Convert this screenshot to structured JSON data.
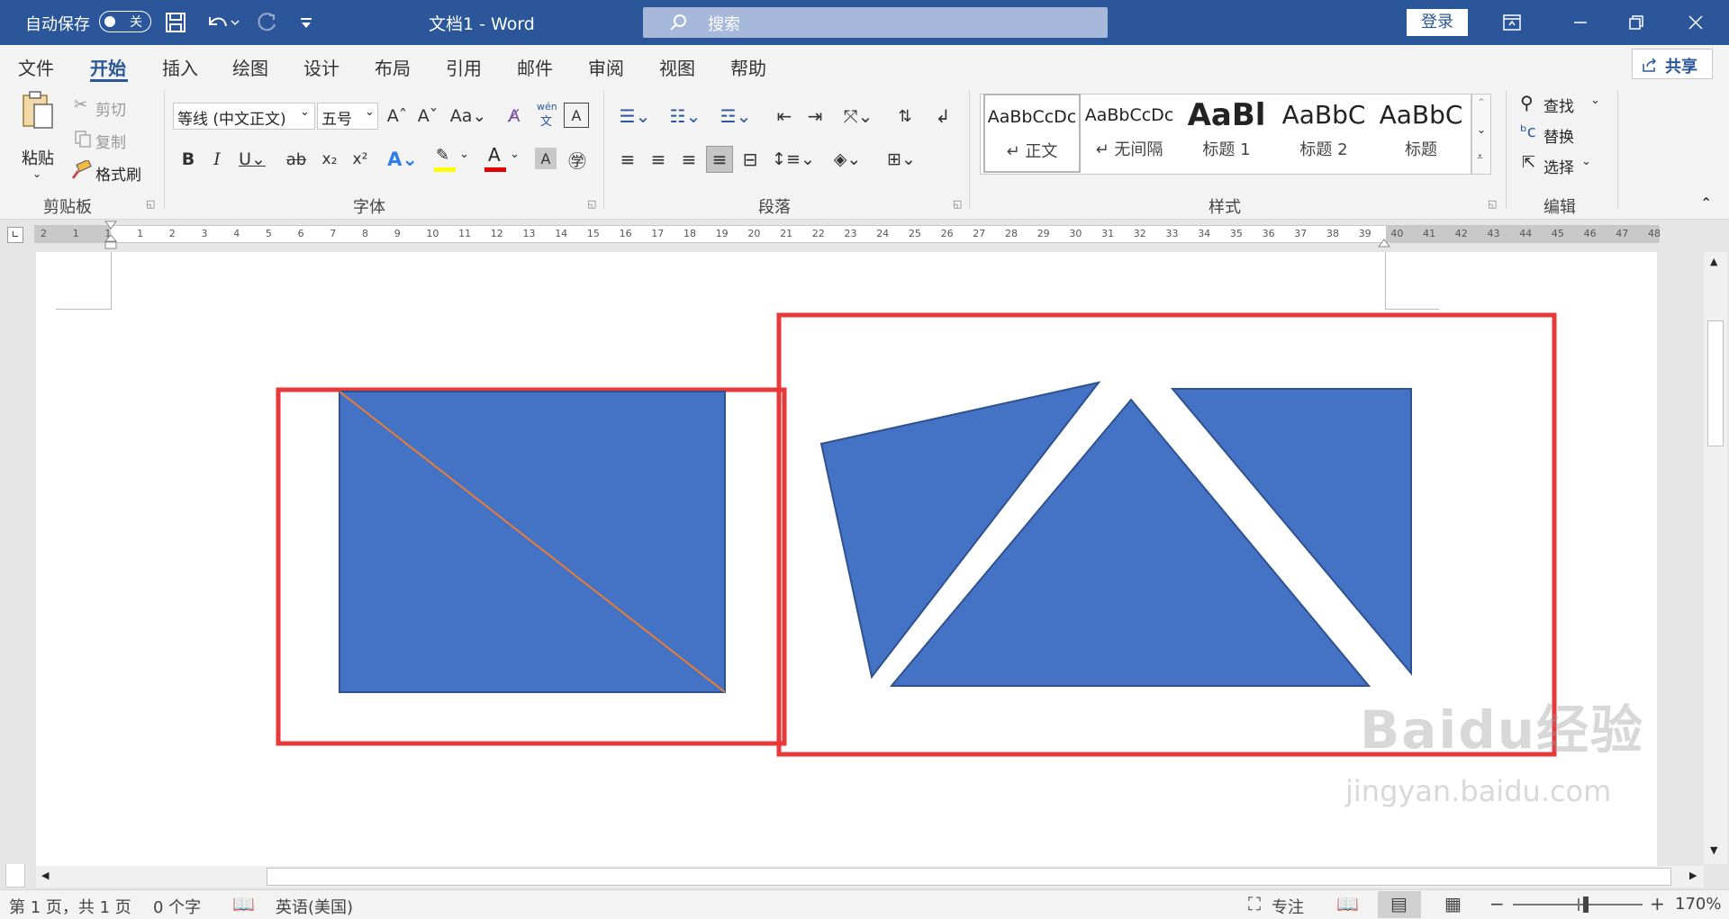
{
  "titlebar": {
    "autosave_label": "自动保存",
    "autosave_state": "关",
    "doc_title": "文档1  -  Word",
    "search_label": "搜索",
    "signin_label": "登录"
  },
  "tabs": [
    "文件",
    "开始",
    "插入",
    "绘图",
    "设计",
    "布局",
    "引用",
    "邮件",
    "审阅",
    "视图",
    "帮助"
  ],
  "share_label": "共享",
  "clipboard": {
    "paste": "粘贴",
    "cut": "剪切",
    "copy": "复制",
    "format_painter": "格式刷",
    "group": "剪贴板"
  },
  "font": {
    "name": "等线 (中文正文)",
    "size": "五号",
    "group": "字体",
    "phonetic_top": "wén",
    "phonetic_bottom": "文"
  },
  "paragraph": {
    "group": "段落"
  },
  "styles": {
    "group": "样式",
    "items": [
      {
        "preview": "AaBbCcDc",
        "name": "↵ 正文"
      },
      {
        "preview": "AaBbCcDc",
        "name": "↵ 无间隔"
      },
      {
        "preview": "AaBl",
        "name": "标题 1"
      },
      {
        "preview": "AaBbC",
        "name": "标题 2"
      },
      {
        "preview": "AaBbC",
        "name": "标题"
      }
    ]
  },
  "editing": {
    "find": "查找",
    "replace": "替换",
    "select": "选择",
    "group": "编辑"
  },
  "ruler_labels": [
    "2",
    "1",
    "1",
    "1",
    "2",
    "3",
    "4",
    "5",
    "6",
    "7",
    "8",
    "9",
    "10",
    "11",
    "12",
    "13",
    "14",
    "15",
    "16",
    "17",
    "18",
    "19",
    "20",
    "21",
    "22",
    "23",
    "24",
    "25",
    "26",
    "27",
    "28",
    "29",
    "30",
    "31",
    "32",
    "33",
    "34",
    "35",
    "36",
    "37",
    "38",
    "39",
    "40",
    "41",
    "42",
    "43",
    "44",
    "45",
    "46",
    "47",
    "48"
  ],
  "status": {
    "page": "第 1 页，共 1 页",
    "words": "0 个字",
    "language": "英语(美国)",
    "focus": "专注",
    "zoom": "170%"
  },
  "watermark": {
    "brand": "Baidu经验",
    "url": "jingyan.baidu.com"
  },
  "colors": {
    "accent": "#2b579a",
    "shape_fill": "#4472c4",
    "shape_stroke": "#2f528f",
    "annotation_red": "#e8393a",
    "diagonal_line": "#ed7d31"
  }
}
